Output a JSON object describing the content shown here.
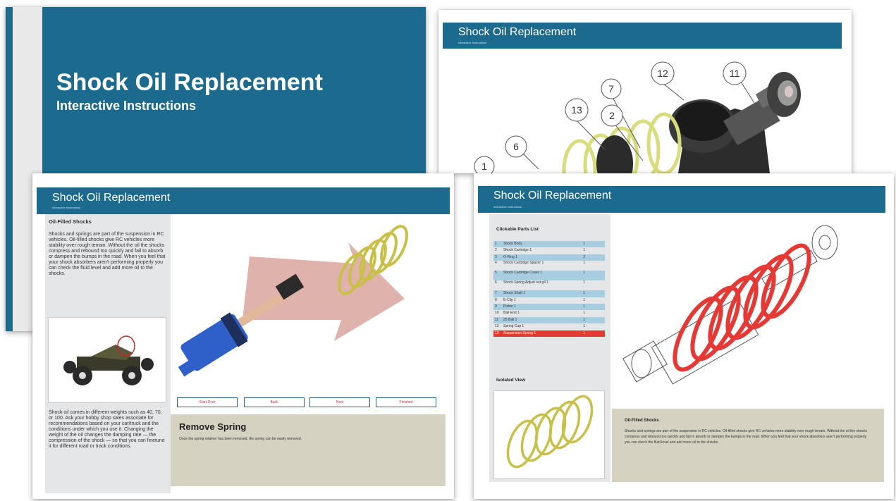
{
  "title_slide": {
    "title": "Shock Oil Replacement",
    "subtitle": "Interactive Instructions"
  },
  "exploded_view": {
    "header_title": "Shock Oil Replacement",
    "header_subtitle": "Interactive Instructions",
    "callouts": [
      "12",
      "11",
      "7",
      "13",
      "2",
      "6",
      "1"
    ]
  },
  "step_view": {
    "header_title": "Shock Oil Replacement",
    "header_subtitle": "Interactive Instructions",
    "sidebar_title": "Oil-Filled Shocks",
    "sidebar_text": "Shocks and springs are part of the suspension in RC vehicles. Oil-filled shocks give RC vehicles more stability over rough terrain. Without the oil the shocks compress and rebound too quickly and fail to absorb or dampen the bumps in the road. When you feel that your shock absorbers aren't performing properly you can check the fluid level and add more oil to the shocks.",
    "sidebar_text2": "Shock oil comes in different weights such as 40, 70, or 100. Ask your hobby shop sales associate for recommendations based on your car/truck and the conditions under which you use it. Changing the weight of the oil changes the damping rate — the compression of the shock — so that you can finetune it for different road or track conditions.",
    "buttons": [
      "Start Over",
      "Back",
      "Next",
      "Finished"
    ],
    "step_title": "Remove Spring",
    "step_text": "Once the spring retainer has been removed, the spring can be easily removed."
  },
  "parts_view": {
    "header_title": "Shock Oil Replacement",
    "header_subtitle": "Interactive Instructions",
    "list_title": "Clickable Parts List",
    "parts": [
      {
        "no": "1",
        "name": "Shock Body",
        "qty": "1"
      },
      {
        "no": "2",
        "name": "Shock Cartridge 1",
        "qty": "1"
      },
      {
        "no": "3",
        "name": "O-Ring 1",
        "qty": "2"
      },
      {
        "no": "4",
        "name": "Shock Cartridge Spacer 1",
        "qty": "1"
      },
      {
        "no": "5",
        "name": "Shock Cartridge Cover 1",
        "qty": "1"
      },
      {
        "no": "6",
        "name": "Shock Spring Adjust nut g4 1",
        "qty": "1"
      },
      {
        "no": "7",
        "name": "Shock Shaft 1",
        "qty": "1"
      },
      {
        "no": "8",
        "name": "E-Clip 1",
        "qty": "1"
      },
      {
        "no": "9",
        "name": "Piston 1",
        "qty": "1"
      },
      {
        "no": "10",
        "name": "Ball End 1",
        "qty": "1"
      },
      {
        "no": "11",
        "name": "25 Ball 1",
        "qty": "1"
      },
      {
        "no": "12",
        "name": "Spring Cup 1",
        "qty": "1"
      },
      {
        "no": "13",
        "name": "Suspension Spring 1",
        "qty": "1"
      }
    ],
    "isolated_title": "Isolated View",
    "caption_title": "Oil-Filled Shocks",
    "caption_text": "Shocks and springs are part of the suspension in RC vehicles. Oil-filled shocks give RC vehicles more stability over rough terrain. Without the oil the shocks compress and rebound too quickly and fail to absorb or dampen the bumps in the road. When you feel that your shock absorbers aren't performing properly you can check the fluid level and add more oil to the shocks."
  },
  "colors": {
    "header_blue": "#1d6a8f",
    "caption_tan": "#d5d2c2",
    "sidebar_grey": "#e5e6e8",
    "highlight_red": "#e53935",
    "list_blue": "#a9cde0"
  }
}
